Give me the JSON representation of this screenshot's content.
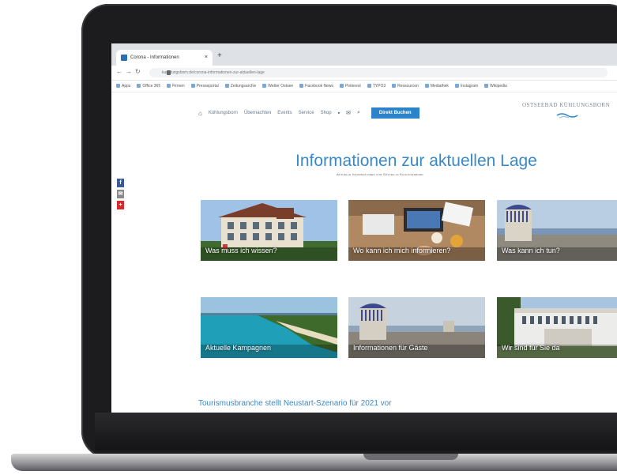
{
  "browser": {
    "tab_title": "Corona - Informationen",
    "tab_close": "×",
    "new_tab": "+",
    "url": "kuehlungsborn.de/corona-informationen-zur-aktuellen-lage",
    "bookmarks": [
      "Apps",
      "Office 365",
      "Firmen",
      "Presseportal",
      "Zeitungsarchiv",
      "Wetter Ostsee",
      "Facebook News",
      "Pinterest",
      "TYPO3",
      "Ressourcen",
      "Mediathek",
      "Instagram",
      "Wikipedia"
    ]
  },
  "site": {
    "nav": {
      "items": [
        "Kühlungsborn",
        "Übernachten",
        "Events",
        "Service",
        "Shop"
      ],
      "cta_label": "Direkt Buchen"
    },
    "logo_text": "OSTSEEBAD KÜHLUNGSBORN",
    "logo_tagline": "Kühlungsborn",
    "hero": {
      "title": "Informationen zur aktuellen Lage",
      "subtitle": "Aktuelle Informationen für Gästen in Kühlungsborn"
    },
    "social": [
      "f",
      "✉",
      "+"
    ],
    "cards": [
      {
        "caption": "Was muss ich wissen?"
      },
      {
        "caption": "Wo kann ich mich informieren?"
      },
      {
        "caption": "Was kann ich tun?"
      },
      {
        "caption": "Aktuelle Kampagnen"
      },
      {
        "caption": "Informationen für Gäste"
      },
      {
        "caption": "Wir sind für Sie da"
      }
    ],
    "news_headline": "Tourismusbranche stellt Neustart-Szenario für 2021 vor"
  },
  "colors": {
    "accent": "#3a89c9",
    "cta": "#2d83c9",
    "facebook": "#3b5998",
    "mail": "#8a8a8a",
    "pinterest": "#d62a2a"
  }
}
